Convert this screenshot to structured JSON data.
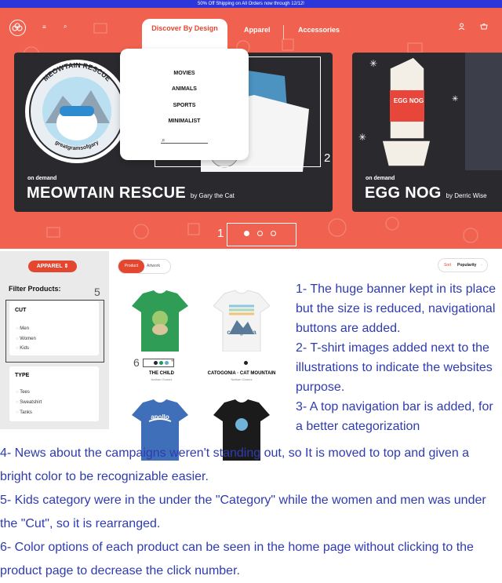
{
  "promo_bar": "50% Off Shipping on All Orders now through 12/12!",
  "nav": {
    "active_tab": "Discover By Design",
    "tabs": [
      "Apparel",
      "Accessories"
    ],
    "icons": [
      "logo-icon",
      "menu-icon",
      "search-icon",
      "user-icon",
      "cart-icon"
    ]
  },
  "dropdown": {
    "items": [
      "MOVIES",
      "ANIMALS",
      "SPORTS",
      "MINIMALIST"
    ],
    "search_placeholder": ""
  },
  "banner": {
    "cards": [
      {
        "tag": "on demand",
        "title": "MEOWTAIN RESCUE",
        "byline": "by Gary the Cat",
        "badge_top": "MEOWTAIN RESCUE",
        "badge_bottom": "greatgramsofgary"
      },
      {
        "tag": "on demand",
        "title": "EGG NOG",
        "byline": "by Derric Wise",
        "carton_label": "EGG NOG"
      }
    ],
    "pagination_dots": 3,
    "active_dot": 0,
    "annotations": {
      "dropdown_num": "2",
      "dots_num": "1"
    }
  },
  "sidebar": {
    "category_button": "APPAREL",
    "filter_title": "Filter Products:",
    "annotation_num": "5",
    "groups": [
      {
        "title": "CUT",
        "options": [
          "Men",
          "Women",
          "Kids"
        ]
      },
      {
        "title": "TYPE",
        "options": [
          "Tees",
          "Sweatshirt",
          "Tanks"
        ]
      }
    ]
  },
  "content": {
    "toggle": [
      "Product",
      "Artwork"
    ],
    "sort": {
      "label": "Sort",
      "value": "Popularity"
    },
    "annotation_num": "6",
    "products": [
      {
        "name": "THE CHILD",
        "by": "Nathan Gomez",
        "swatches": [
          "#1f2a33",
          "#1f9a5b",
          "#5bb0c7"
        ],
        "extra": "+"
      },
      {
        "name": "CATOGONIA · CAT MOUNTAIN",
        "by": "Nathan Gomez",
        "swatches": [
          "#222222"
        ],
        "shirt_text": "catagonia"
      },
      {
        "name": "",
        "by": "",
        "shirt_text": "apollo"
      },
      {
        "name": "",
        "by": ""
      }
    ]
  },
  "notes_right": [
    "1- The huge banner kept in its place but the size is reduced, navigational buttons are added.",
    "2- T-shirt images added next to the illustrations to indicate the websites purpose.",
    "3- A top navigation bar is added, for a better categorization"
  ],
  "notes_bottom": [
    "4- News about the campaigns weren't standing out, so It is moved to top and given a bright color to be recognizable easier.",
    "5- Kids category were in the under the \"Category\" while the women and men was under the \"Cut\", so it is rearranged.",
    "6- Color options of each product can be seen in the home page without clicking to the product page to decrease the click number."
  ],
  "colors": {
    "accent": "#e3472f",
    "hero_bg": "#f0624f",
    "promo": "#2d36d8",
    "notes": "#2f3bb0"
  }
}
